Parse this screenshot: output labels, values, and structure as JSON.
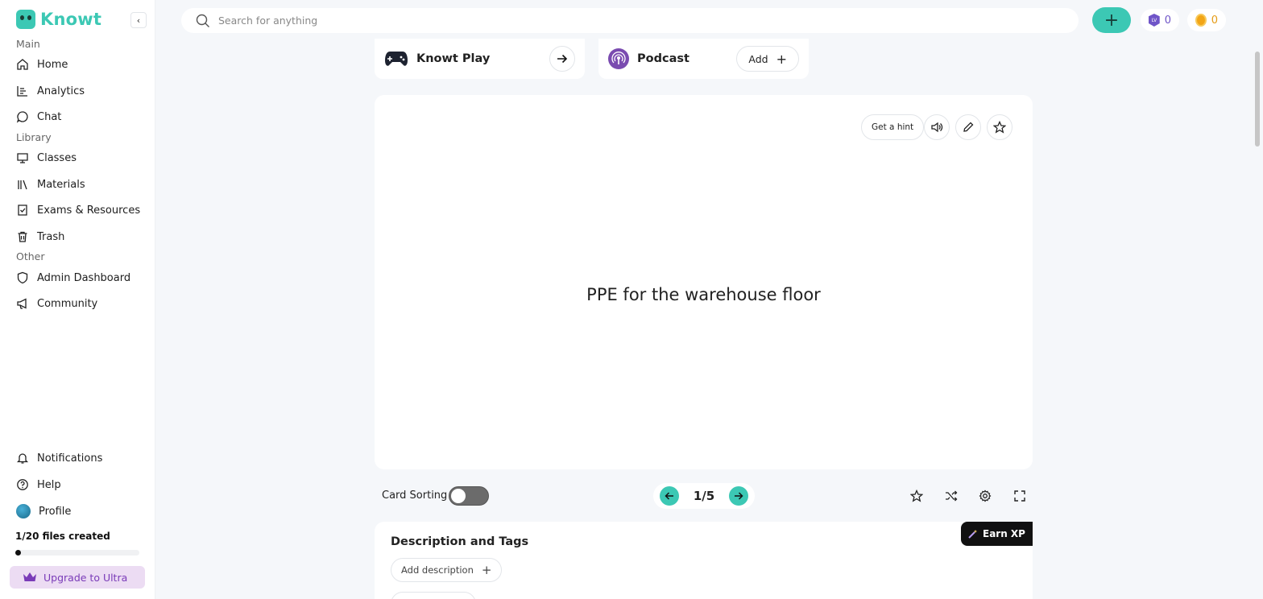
{
  "app": {
    "name": "Knowt"
  },
  "sidebar": {
    "sections": {
      "main": "Main",
      "library": "Library",
      "other": "Other"
    },
    "main_items": [
      {
        "label": "Home",
        "icon": "home-icon"
      },
      {
        "label": "Analytics",
        "icon": "analytics-icon"
      },
      {
        "label": "Chat",
        "icon": "chat-icon"
      }
    ],
    "library_items": [
      {
        "label": "Classes",
        "icon": "classes-icon"
      },
      {
        "label": "Materials",
        "icon": "materials-icon"
      },
      {
        "label": "Exams & Resources",
        "icon": "exams-icon"
      },
      {
        "label": "Trash",
        "icon": "trash-icon"
      }
    ],
    "other_items": [
      {
        "label": "Admin Dashboard",
        "icon": "shield-icon"
      },
      {
        "label": "Community",
        "icon": "megaphone-icon"
      }
    ],
    "bottom_items": [
      {
        "label": "Notifications",
        "icon": "bell-icon"
      },
      {
        "label": "Help",
        "icon": "help-icon"
      },
      {
        "label": "Profile",
        "icon": "avatar"
      }
    ],
    "files": {
      "label": "1/20 files created",
      "used": 1,
      "total": 20
    },
    "upgrade_label": "Upgrade to Ultra"
  },
  "topbar": {
    "search_placeholder": "Search for anything",
    "level_count": "0",
    "coin_count": "0",
    "level_badge": "LV"
  },
  "cards": {
    "play_title": "Knowt Play",
    "podcast_title": "Podcast",
    "podcast_add": "Add"
  },
  "flashcard": {
    "hint_label": "Get a hint",
    "term": "PPE for the warehouse floor"
  },
  "controls": {
    "card_sorting_label": "Card Sorting",
    "card_sorting_on": false,
    "page": "1/5"
  },
  "description": {
    "title": "Description and Tags",
    "earn_xp": "Earn XP",
    "add_description": "Add description"
  },
  "colors": {
    "accent": "#3cc8b4",
    "level": "#6f55c8",
    "coin": "#e59b14",
    "upgrade": "#7a3bb8"
  }
}
